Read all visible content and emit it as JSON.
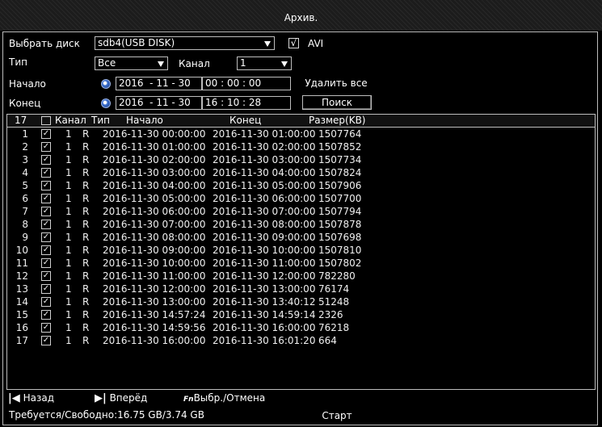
{
  "window": {
    "title": "Архив."
  },
  "form": {
    "disk_label": "Выбрать диск",
    "disk_value": "sdb4(USB DISK)",
    "avi_checked": "√",
    "avi_label": "AVI",
    "type_label": "Тип",
    "type_value": "Все",
    "channel_label": "Канал",
    "channel_value": "1",
    "start_label": "Начало",
    "start_date": "2016  - 11 - 30",
    "start_time": "00 : 00 : 00",
    "end_label": "Конец",
    "end_date": "2016  - 11 - 30",
    "end_time": "16 : 10 : 28",
    "delete_all_label": "Удалить все",
    "search_label": "Поиск"
  },
  "table": {
    "count": "17",
    "headers": {
      "channel": "Канал",
      "type": "Тип",
      "start": "Начало",
      "end": "Конец",
      "size": "Размер(KB)"
    },
    "rows": [
      {
        "num": "1",
        "checked": "✓",
        "channel": "1",
        "type": "R",
        "start": "2016-11-30 00:00:00",
        "end": "2016-11-30 01:00:00",
        "size": "1507764"
      },
      {
        "num": "2",
        "checked": "✓",
        "channel": "1",
        "type": "R",
        "start": "2016-11-30 01:00:00",
        "end": "2016-11-30 02:00:00",
        "size": "1507852"
      },
      {
        "num": "3",
        "checked": "✓",
        "channel": "1",
        "type": "R",
        "start": "2016-11-30 02:00:00",
        "end": "2016-11-30 03:00:00",
        "size": "1507734"
      },
      {
        "num": "4",
        "checked": "✓",
        "channel": "1",
        "type": "R",
        "start": "2016-11-30 03:00:00",
        "end": "2016-11-30 04:00:00",
        "size": "1507824"
      },
      {
        "num": "5",
        "checked": "✓",
        "channel": "1",
        "type": "R",
        "start": "2016-11-30 04:00:00",
        "end": "2016-11-30 05:00:00",
        "size": "1507906"
      },
      {
        "num": "6",
        "checked": "✓",
        "channel": "1",
        "type": "R",
        "start": "2016-11-30 05:00:00",
        "end": "2016-11-30 06:00:00",
        "size": "1507700"
      },
      {
        "num": "7",
        "checked": "✓",
        "channel": "1",
        "type": "R",
        "start": "2016-11-30 06:00:00",
        "end": "2016-11-30 07:00:00",
        "size": "1507794"
      },
      {
        "num": "8",
        "checked": "✓",
        "channel": "1",
        "type": "R",
        "start": "2016-11-30 07:00:00",
        "end": "2016-11-30 08:00:00",
        "size": "1507878"
      },
      {
        "num": "9",
        "checked": "✓",
        "channel": "1",
        "type": "R",
        "start": "2016-11-30 08:00:00",
        "end": "2016-11-30 09:00:00",
        "size": "1507698"
      },
      {
        "num": "10",
        "checked": "✓",
        "channel": "1",
        "type": "R",
        "start": "2016-11-30 09:00:00",
        "end": "2016-11-30 10:00:00",
        "size": "1507810"
      },
      {
        "num": "11",
        "checked": "✓",
        "channel": "1",
        "type": "R",
        "start": "2016-11-30 10:00:00",
        "end": "2016-11-30 11:00:00",
        "size": "1507802"
      },
      {
        "num": "12",
        "checked": "✓",
        "channel": "1",
        "type": "R",
        "start": "2016-11-30 11:00:00",
        "end": "2016-11-30 12:00:00",
        "size": "782280"
      },
      {
        "num": "13",
        "checked": "✓",
        "channel": "1",
        "type": "R",
        "start": "2016-11-30 12:00:00",
        "end": "2016-11-30 13:00:00",
        "size": "76174"
      },
      {
        "num": "14",
        "checked": "✓",
        "channel": "1",
        "type": "R",
        "start": "2016-11-30 13:00:00",
        "end": "2016-11-30 13:40:12",
        "size": "51248"
      },
      {
        "num": "15",
        "checked": "✓",
        "channel": "1",
        "type": "R",
        "start": "2016-11-30 14:57:24",
        "end": "2016-11-30 14:59:14",
        "size": "2326"
      },
      {
        "num": "16",
        "checked": "✓",
        "channel": "1",
        "type": "R",
        "start": "2016-11-30 14:59:56",
        "end": "2016-11-30 16:00:00",
        "size": "76218"
      },
      {
        "num": "17",
        "checked": "✓",
        "channel": "1",
        "type": "R",
        "start": "2016-11-30 16:00:00",
        "end": "2016-11-30 16:01:20",
        "size": "664"
      }
    ]
  },
  "footer": {
    "back_label": "Назад",
    "forward_label": "Вперёд",
    "fn_glyph": "Fn",
    "select_cancel_label": "Выбр./Отмена",
    "storage_text": "Требуется/Свободно:16.75 GB/3.74 GB",
    "start_label": "Старт"
  },
  "icons": {
    "dropdown": "dropdown-arrow-icon",
    "calendar": "clock-icon",
    "back": "skip-back-icon",
    "forward": "skip-forward-icon",
    "fn": "fn-key-icon"
  }
}
